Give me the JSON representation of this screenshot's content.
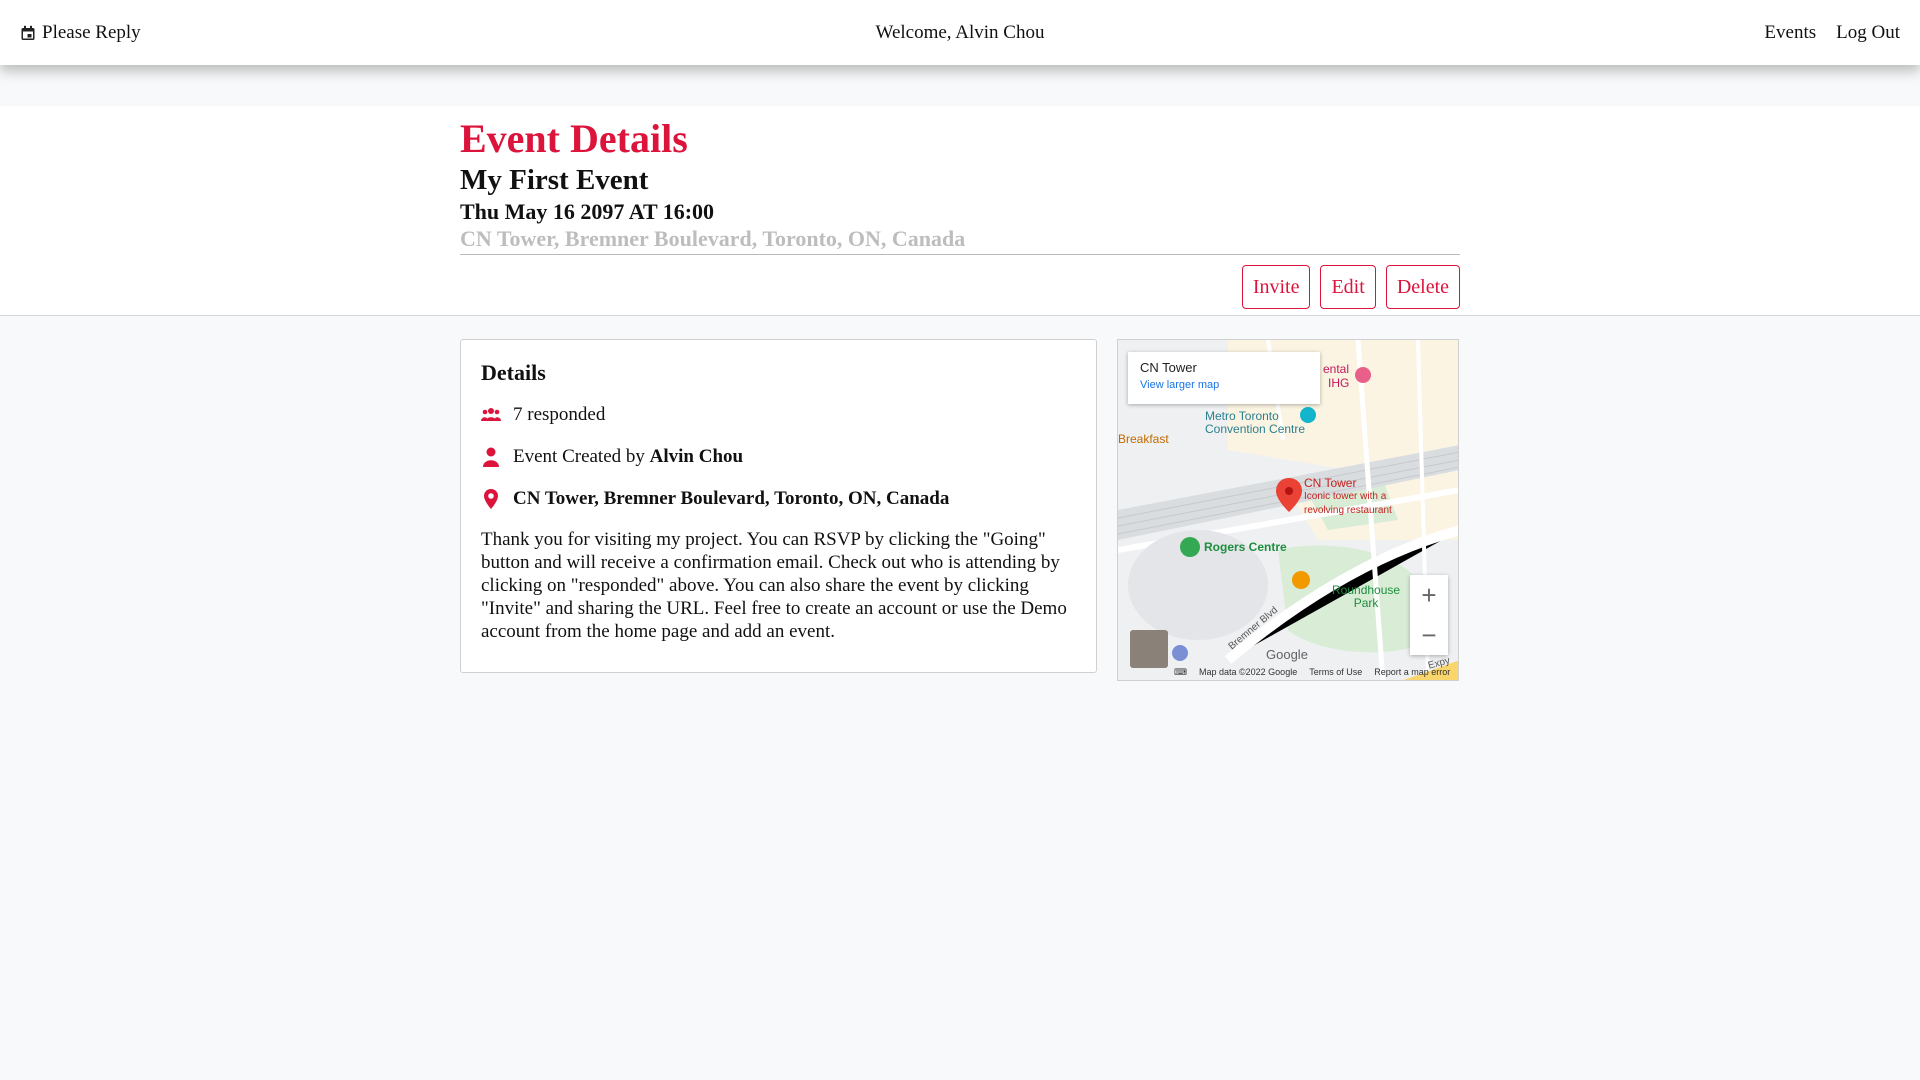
{
  "nav": {
    "brand": "Please Reply",
    "welcome": "Welcome, Alvin Chou",
    "links": [
      "Events",
      "Log Out"
    ]
  },
  "header": {
    "title": "Event Details",
    "event_name": "My First Event",
    "event_date": "Thu May 16 2097 AT 16:00",
    "location": "CN Tower, Bremner Boulevard, Toronto, ON, Canada",
    "buttons": {
      "invite": "Invite",
      "edit": "Edit",
      "delete": "Delete"
    }
  },
  "details": {
    "title": "Details",
    "responded": "7 responded",
    "created_by_prefix": "Event Created by",
    "created_by_name": "Alvin Chou",
    "location": "CN Tower, Bremner Boulevard, Toronto, ON, Canada",
    "description": "Thank you for visiting my project. You can RSVP by clicking the \"Going\" button and will receive a confirmation email. Check out who is attending by clicking on \"responded\" above. You can also share the event by clicking \"Invite\" and sharing the URL. Feel free to create an account or use the Demo account from the home page and add an event."
  },
  "map": {
    "info_title": "CN Tower",
    "info_link": "View larger map",
    "labels": {
      "cn_tower": "CN Tower",
      "cn_tower_sub1": "Iconic tower with a",
      "cn_tower_sub2": "revolving restaurant",
      "metro1": "Metro Toronto",
      "metro2": "Convention Centre",
      "rogers": "Rogers Centre",
      "roundhouse1": "Roundhouse",
      "roundhouse2": "Park",
      "breakfast": "Breakfast",
      "ental": "ental",
      "ihg": "IHG",
      "bremner": "Bremner Blvd",
      "expy": "Expy"
    },
    "footer": {
      "data": "Map data ©2022 Google",
      "terms": "Terms of Use",
      "report": "Report a map error"
    },
    "google": "Google",
    "zoom_in": "+",
    "zoom_out": "−"
  },
  "colors": {
    "accent": "#dc143c",
    "muted": "#bdbdbd",
    "background": "#f8f9fa"
  }
}
